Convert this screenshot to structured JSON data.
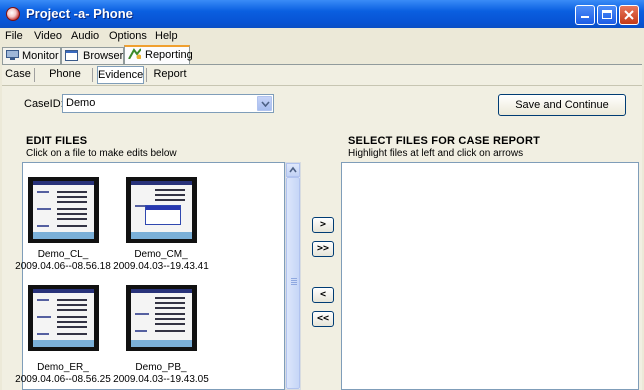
{
  "window": {
    "title": "Project -a- Phone"
  },
  "menu": [
    "File",
    "Video",
    "Audio",
    "Options",
    "Help"
  ],
  "top_tabs": [
    "Monitor",
    "Browser",
    "Reporting"
  ],
  "sub_tabs": [
    "Case",
    "Phone",
    "Evidence",
    "Report"
  ],
  "case": {
    "label": "CaseID:",
    "value": "Demo"
  },
  "save_button": "Save and Continue",
  "edit": {
    "title": "EDIT FILES",
    "subtitle": "Click on a file to make edits below"
  },
  "select": {
    "title": "SELECT FILES FOR CASE REPORT",
    "subtitle": "Highlight files at left and click on arrows"
  },
  "arrows": [
    ">",
    ">>",
    "<",
    "<<"
  ],
  "files": [
    {
      "name": "Demo_CL_",
      "date": "2009.04.06--08.56.18"
    },
    {
      "name": "Demo_CM_",
      "date": "2009.04.03--19.43.41"
    },
    {
      "name": "Demo_ER_",
      "date": "2009.04.06--08.56.25"
    },
    {
      "name": "Demo_PB_",
      "date": "2009.04.03--19.43.05"
    }
  ],
  "icons": {
    "app": "app-icon",
    "monitor": "monitor-icon",
    "browser": "browser-icon",
    "reporting": "reporting-icon",
    "dropdown": "chevron-down-icon",
    "scroll_up": "scroll-up-icon"
  },
  "colors": {
    "titlebar": "#0a5fe0",
    "tab_highlight": "#f0a030",
    "button_border": "#003c74"
  }
}
